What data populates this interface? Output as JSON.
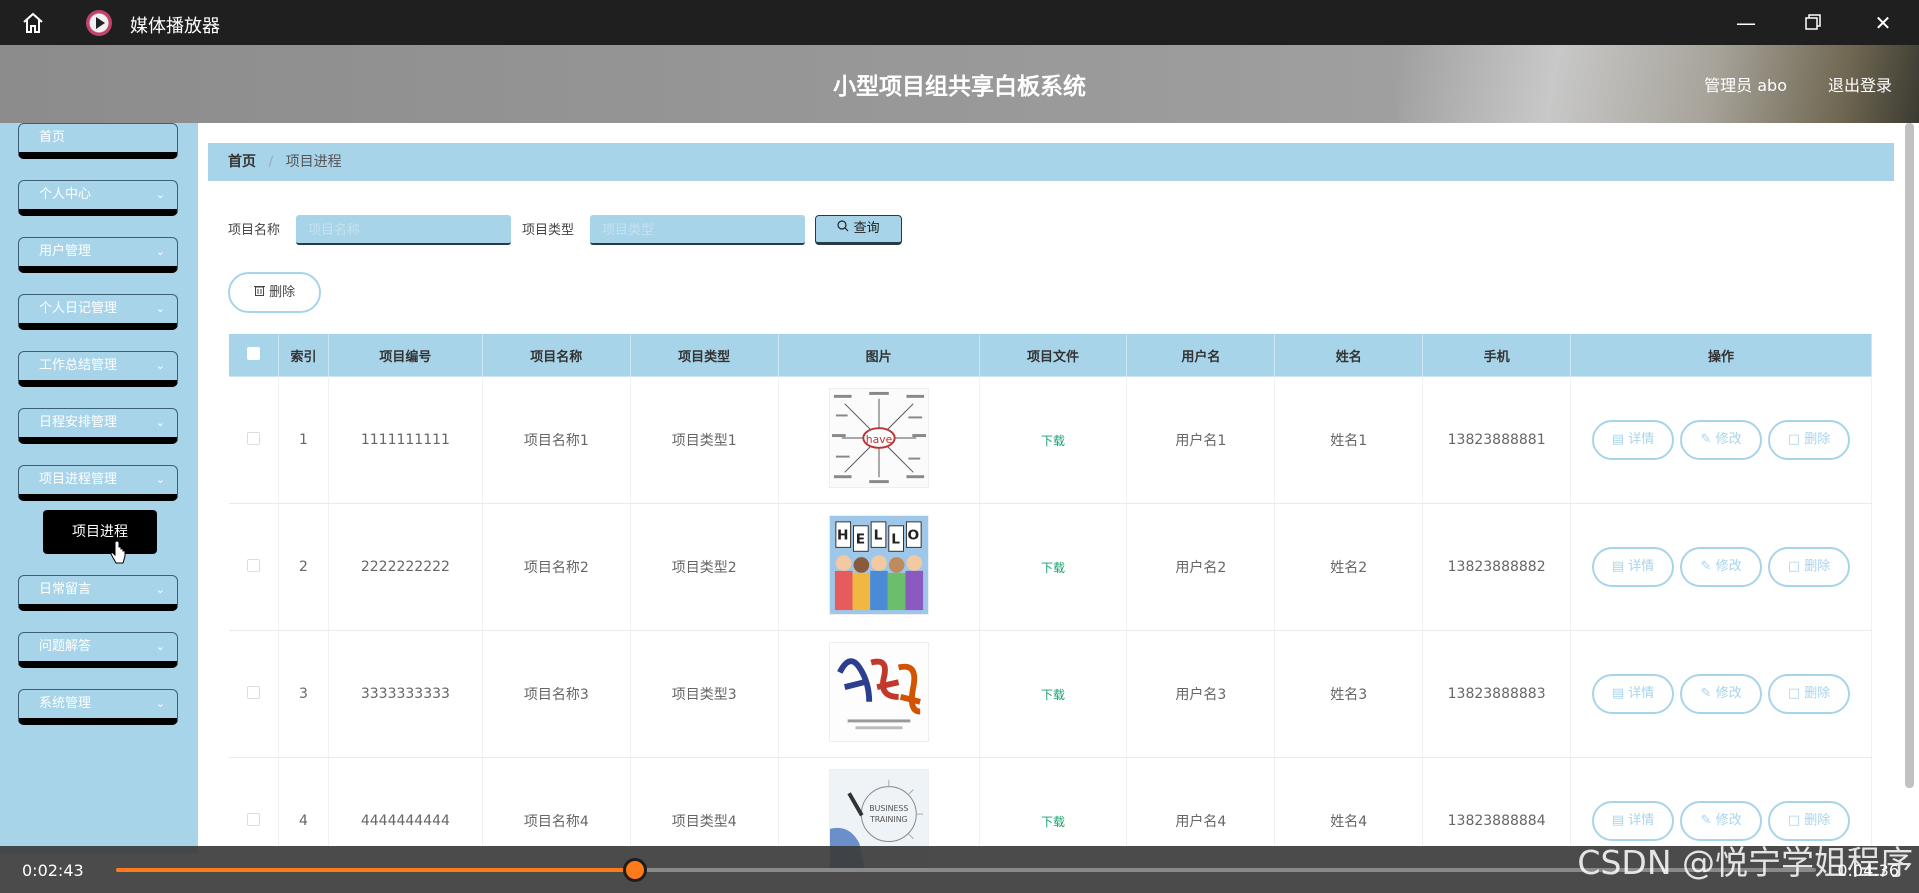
{
  "window": {
    "title": "媒体播放器"
  },
  "header": {
    "system_title": "小型项目组共享白板系统",
    "admin": "管理员 abo",
    "logout": "退出登录"
  },
  "sidebar": {
    "items": [
      {
        "label": "首页"
      },
      {
        "label": "个人中心"
      },
      {
        "label": "用户管理"
      },
      {
        "label": "个人日记管理"
      },
      {
        "label": "工作总结管理"
      },
      {
        "label": "日程安排管理"
      },
      {
        "label": "项目进程管理"
      },
      {
        "label": "日常留言"
      },
      {
        "label": "问题解答"
      },
      {
        "label": "系统管理"
      }
    ],
    "submenu_active": "项目进程"
  },
  "breadcrumb": {
    "home": "首页",
    "separator": "/",
    "current": "项目进程"
  },
  "search": {
    "name_label": "项目名称",
    "name_placeholder": "项目名称",
    "type_label": "项目类型",
    "type_placeholder": "项目类型",
    "query_label": "查询"
  },
  "delete_button": "删除",
  "table": {
    "headers": [
      "",
      "索引",
      "项目编号",
      "项目名称",
      "项目类型",
      "图片",
      "项目文件",
      "用户名",
      "姓名",
      "手机",
      "操作"
    ],
    "rows": [
      {
        "index": "1",
        "code": "1111111111",
        "name": "项目名称1",
        "type": "项目类型1",
        "file": "下载",
        "user": "用户名1",
        "realname": "姓名1",
        "phone": "13823888881",
        "image": "have-word-map"
      },
      {
        "index": "2",
        "code": "2222222222",
        "name": "项目名称2",
        "type": "项目类型2",
        "file": "下载",
        "user": "用户名2",
        "realname": "姓名2",
        "phone": "13823888882",
        "image": "hello-kids"
      },
      {
        "index": "3",
        "code": "3333333333",
        "name": "项目名称3",
        "type": "项目类型3",
        "file": "下载",
        "user": "用户名3",
        "realname": "姓名3",
        "phone": "13823888883",
        "image": "calligraphy"
      },
      {
        "index": "4",
        "code": "4444444444",
        "name": "项目名称4",
        "type": "项目类型4",
        "file": "下载",
        "user": "用户名4",
        "realname": "姓名4",
        "phone": "13823888884",
        "image": "business-training"
      }
    ],
    "actions": {
      "detail": "详情",
      "edit": "修改",
      "delete": "删除"
    }
  },
  "player": {
    "current_time": "0:02:43",
    "total_time": "0:04:36",
    "progress": 0.305
  },
  "watermark": "CSDN @悦宁学姐程序",
  "colors": {
    "accent": "#a8d4ea",
    "header": "#9a9a9a",
    "player_progress": "#ff7a1a",
    "download": "#1aa06d"
  }
}
